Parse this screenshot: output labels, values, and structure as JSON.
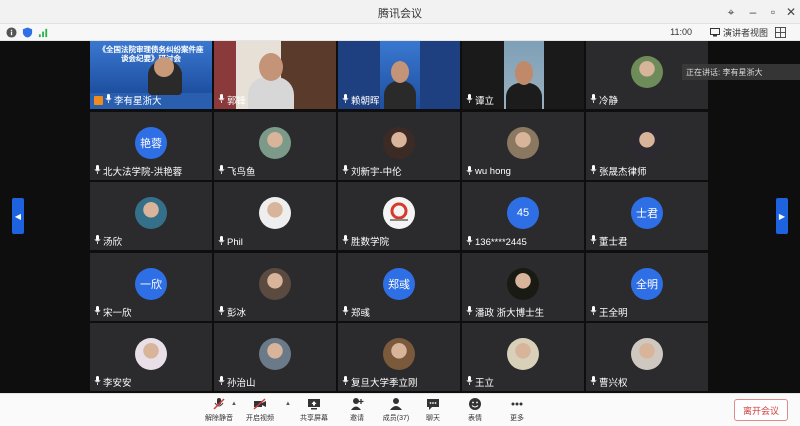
{
  "window": {
    "title": "腾讯会议"
  },
  "status": {
    "time": "11:00",
    "view_label": "演讲者视图"
  },
  "speaking": {
    "text": "正在讲话: 李有星浙大"
  },
  "participants": [
    {
      "name": "李有星浙大",
      "kind": "video-slide",
      "slide_text": "《全国法院审理债务纠纷案件座谈会纪要》研讨会"
    },
    {
      "name": "郭锋",
      "kind": "video-person"
    },
    {
      "name": "赖朝晖",
      "kind": "video-slide2"
    },
    {
      "name": "谭立",
      "kind": "video-person2"
    },
    {
      "name": "冷静",
      "kind": "photo",
      "color": "#6d8c5a"
    },
    {
      "name": "北大法学院-洪艳蓉",
      "kind": "text",
      "avatar_text": "艳蓉"
    },
    {
      "name": "飞鸟鱼",
      "kind": "photo",
      "color": "#7c9a8a"
    },
    {
      "name": "刘新宇-中伦",
      "kind": "photo",
      "color": "#3c2a25"
    },
    {
      "name": "wu hong",
      "kind": "photo",
      "color": "#8a7860"
    },
    {
      "name": "张晟杰律师",
      "kind": "photo",
      "color": "#2c2a30"
    },
    {
      "name": "汤欣",
      "kind": "photo",
      "color": "#35708a"
    },
    {
      "name": "Phil",
      "kind": "photo",
      "color": "#eeeeee"
    },
    {
      "name": "胜数学院",
      "kind": "logo",
      "color": "#f4f4f4"
    },
    {
      "name": "136****2445",
      "kind": "text",
      "avatar_text": "45"
    },
    {
      "name": "董士君",
      "kind": "text",
      "avatar_text": "士君"
    },
    {
      "name": "宋一欣",
      "kind": "text",
      "avatar_text": "一欣"
    },
    {
      "name": "彭冰",
      "kind": "photo",
      "color": "#5a4a40"
    },
    {
      "name": "郑彧",
      "kind": "text",
      "avatar_text": "郑彧"
    },
    {
      "name": "潘政 浙大博士生",
      "kind": "photo",
      "color": "#1a1a14"
    },
    {
      "name": "王全明",
      "kind": "text",
      "avatar_text": "全明"
    },
    {
      "name": "李安安",
      "kind": "photo",
      "color": "#e8dfe8"
    },
    {
      "name": "孙治山",
      "kind": "photo",
      "color": "#6a7a88"
    },
    {
      "name": "复旦大学季立刚",
      "kind": "photo",
      "color": "#7a5a3a"
    },
    {
      "name": "王立",
      "kind": "photo",
      "color": "#d8d0b8"
    },
    {
      "name": "曹兴权",
      "kind": "photo",
      "color": "#cfc8c0"
    }
  ],
  "toolbar": {
    "items": [
      {
        "label": "解除静音",
        "icon": "mic-muted-icon"
      },
      {
        "label": "开启视频",
        "icon": "camera-off-icon"
      },
      {
        "label": "共享屏幕",
        "icon": "share-screen-icon"
      },
      {
        "label": "邀请",
        "icon": "invite-icon"
      },
      {
        "label": "成员(37)",
        "icon": "members-icon"
      },
      {
        "label": "聊天",
        "icon": "chat-icon"
      },
      {
        "label": "表情",
        "icon": "emoji-icon"
      },
      {
        "label": "更多",
        "icon": "more-icon"
      }
    ],
    "leave_label": "离开会议"
  },
  "colors": {
    "accent": "#2f6fe6",
    "leave": "#d23c3c"
  }
}
